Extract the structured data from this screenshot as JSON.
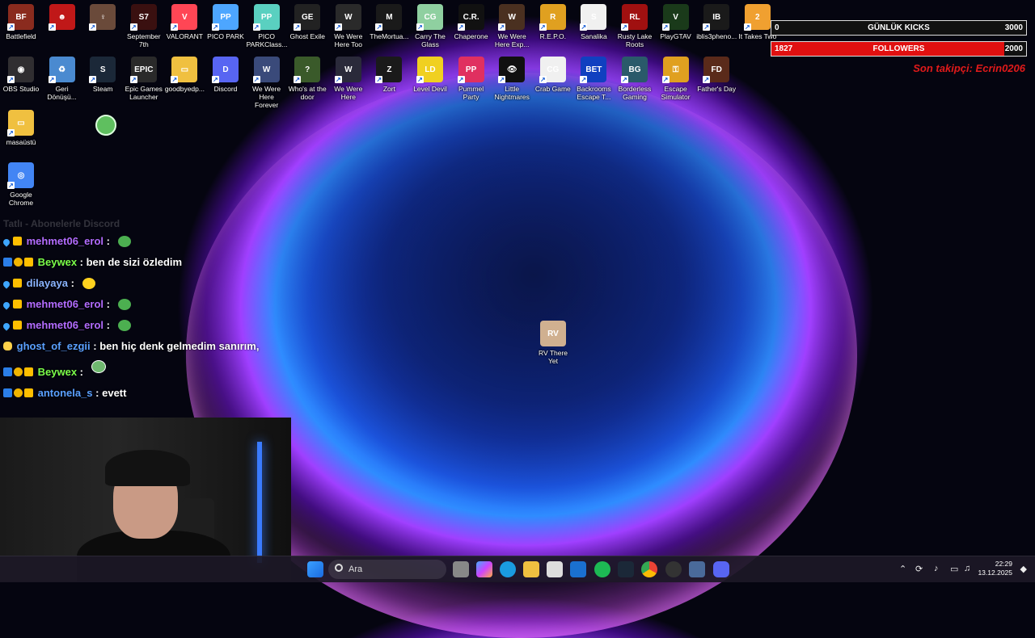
{
  "desktop": {
    "row1": [
      {
        "label": "Battlefield",
        "color": "#8a2b1e",
        "text": "BF"
      },
      {
        "label": "",
        "color": "#c01818",
        "text": "☻"
      },
      {
        "label": "",
        "color": "#6a4a3a",
        "text": "♀"
      },
      {
        "label": "September 7th",
        "color": "#3a1010",
        "text": "S7"
      },
      {
        "label": "VALORANT",
        "color": "#ff4655",
        "text": "V"
      },
      {
        "label": "PICO PARK",
        "color": "#4da6ff",
        "text": "PP"
      },
      {
        "label": "PICO PARKClass...",
        "color": "#5ad0c0",
        "text": "PP"
      },
      {
        "label": "Ghost Exile",
        "color": "#222222",
        "text": "GE"
      },
      {
        "label": "We Were Here Too",
        "color": "#2a2a2a",
        "text": "W"
      },
      {
        "label": "TheMortua...",
        "color": "#1a1a1a",
        "text": "M"
      },
      {
        "label": "Carry The Glass",
        "color": "#8fd0a0",
        "text": "CG"
      },
      {
        "label": "Chaperone",
        "color": "#111111",
        "text": "C.R."
      },
      {
        "label": "We Were Here Exp...",
        "color": "#4a3020",
        "text": "W"
      },
      {
        "label": "R.E.P.O.",
        "color": "#e0a020",
        "text": "R"
      },
      {
        "label": "Sanalika",
        "color": "#f0f0f0",
        "text": "S"
      },
      {
        "label": "Rusty Lake Roots",
        "color": "#a01010",
        "text": "RL"
      },
      {
        "label": "PlayGTAV",
        "color": "#1a3a1a",
        "text": "V"
      },
      {
        "label": "iblis3pheno...",
        "color": "#1a1a1a",
        "text": "IB"
      },
      {
        "label": "It Takes Two",
        "color": "#f0a030",
        "text": "2"
      }
    ],
    "row2": [
      {
        "label": "OBS Studio",
        "color": "#302e31",
        "text": "◉"
      },
      {
        "label": "Geri Dönüşü...",
        "color": "#4a8ad0",
        "text": "♻"
      },
      {
        "label": "Steam",
        "color": "#1b2838",
        "text": "S"
      },
      {
        "label": "Epic Games Launcher",
        "color": "#2a2a2a",
        "text": "EPIC"
      },
      {
        "label": "goodbyedp...",
        "color": "#f0c040",
        "text": "▭"
      },
      {
        "label": "Discord",
        "color": "#5865f2",
        "text": "D"
      },
      {
        "label": "We Were Here Forever",
        "color": "#3a4a7a",
        "text": "W"
      },
      {
        "label": "Who's at the door",
        "color": "#3a5a2a",
        "text": "?"
      },
      {
        "label": "We Were Here",
        "color": "#2a2a3a",
        "text": "W"
      },
      {
        "label": "Zort",
        "color": "#1a1a1a",
        "text": "Z"
      },
      {
        "label": "Level Devil",
        "color": "#f0d020",
        "text": "LD"
      },
      {
        "label": "Pummel Party",
        "color": "#e03060",
        "text": "PP"
      },
      {
        "label": "Little Nightmares",
        "color": "#101010",
        "text": "👁"
      },
      {
        "label": "Crab Game",
        "color": "#f0f0f0",
        "text": "CG"
      },
      {
        "label": "Backrooms Escape T...",
        "color": "#1040c0",
        "text": "BET"
      },
      {
        "label": "Borderless Gaming",
        "color": "#2a5a6a",
        "text": "BG"
      },
      {
        "label": "Escape Simulator",
        "color": "#e0a020",
        "text": "⚿"
      },
      {
        "label": "Father's Day",
        "color": "#5a2a1a",
        "text": "FD"
      }
    ],
    "col": [
      {
        "label": "masaüstü",
        "color": "#f0c040",
        "text": "▭"
      },
      {
        "label": "Google Chrome",
        "color": "#4285f4",
        "text": "◎"
      }
    ],
    "center_icon": {
      "label": "RV There Yet",
      "color": "#d0b090",
      "text": "RV"
    }
  },
  "overlay": {
    "kicks": {
      "current": "0",
      "title": "GÜNLÜK KICKS",
      "goal": "3000",
      "progress": 0
    },
    "followers": {
      "current": "1827",
      "title": "FOLLOWERS",
      "goal": "2000",
      "progress": 0.9135
    },
    "last_follower": "Son takipçi: Ecrin0206"
  },
  "chat": {
    "ghost_line": "Tatlı - Abonelerle Discord",
    "messages": [
      {
        "user": "mehmet06_erol",
        "color": "#b36cff",
        "text": "",
        "emote": "green"
      },
      {
        "user": "Beywex",
        "color": "#7cff4a",
        "text": "ben de sizi özledim",
        "emote": ""
      },
      {
        "user": "dilayaya",
        "color": "#8ab4ff",
        "text": "",
        "emote": "yellow"
      },
      {
        "user": "mehmet06_erol",
        "color": "#b36cff",
        "text": "",
        "emote": "green"
      },
      {
        "user": "mehmet06_erol",
        "color": "#b36cff",
        "text": "",
        "emote": "green"
      },
      {
        "user": "ghost_of_ezgii",
        "color": "#5aa0ff",
        "text": "ben hiç denk gelmedim sanırım,",
        "emote": ""
      },
      {
        "user": "Beywex",
        "color": "#7cff4a",
        "text": "",
        "emote": "ghost"
      },
      {
        "user": "antonela_s",
        "color": "#5aa0ff",
        "text": "evett",
        "emote": ""
      }
    ]
  },
  "taskbar": {
    "search_placeholder": "Ara",
    "time": "22:29",
    "date": "13.12.2025"
  }
}
